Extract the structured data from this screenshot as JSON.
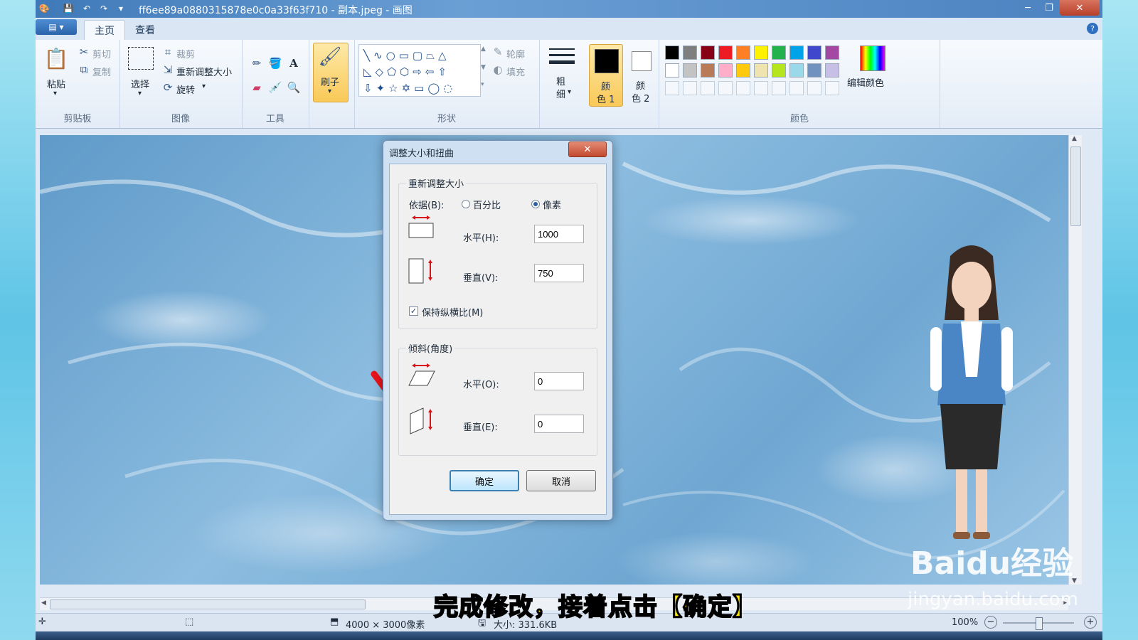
{
  "window": {
    "title": "ff6ee89a0880315878e0c0a33f63f710 - 副本.jpeg - 画图",
    "minimize": "─",
    "restore": "❐",
    "close": "✕"
  },
  "tabs": [
    {
      "label": "主页"
    },
    {
      "label": "查看"
    }
  ],
  "ribbon": {
    "clipboard": {
      "paste": "粘贴",
      "cut": "剪切",
      "copy": "复制",
      "group": "剪贴板"
    },
    "image": {
      "select": "选择",
      "crop": "裁剪",
      "resize": "重新调整大小",
      "rotate": "旋转",
      "group": "图像"
    },
    "tools": {
      "group": "工具"
    },
    "brushes": {
      "label": "刷子"
    },
    "shapes": {
      "outline": "轮廓",
      "fill": "填充",
      "group": "形状"
    },
    "size": {
      "label_line1": "粗",
      "label_line2": "细"
    },
    "color1": {
      "line1": "颜",
      "line2": "色 1"
    },
    "color2": {
      "line1": "颜",
      "line2": "色 2"
    },
    "colors": {
      "group": "颜色",
      "edit": "编辑颜色",
      "row1": [
        "#000000",
        "#7f7f7f",
        "#880015",
        "#ed1c24",
        "#ff7f27",
        "#fff200",
        "#22b14c",
        "#00a2e8",
        "#3f48cc",
        "#a349a4"
      ],
      "row2": [
        "#ffffff",
        "#c3c3c3",
        "#b97a57",
        "#ffaec9",
        "#ffc90e",
        "#efe4b0",
        "#b5e61d",
        "#99d9ea",
        "#7092be",
        "#c8bfe7"
      ]
    }
  },
  "dialog": {
    "title": "调整大小和扭曲",
    "resize_legend": "重新调整大小",
    "by_label": "依据(B):",
    "percent": "百分比",
    "pixels": "像素",
    "horizontal_label": "水平(H):",
    "horizontal_value": "1000",
    "vertical_label": "垂直(V):",
    "vertical_value": "750",
    "keep_ratio": "保持纵横比(M)",
    "skew_legend": "倾斜(角度)",
    "skew_h_label": "水平(O):",
    "skew_h_value": "0",
    "skew_v_label": "垂直(E):",
    "skew_v_value": "0",
    "ok": "确定",
    "cancel": "取消"
  },
  "status": {
    "dimensions": "4000 × 3000像素",
    "size": "大小: 331.6KB",
    "zoom": "100%"
  },
  "overlay": {
    "caption": "完成修改，接着点击【确定】",
    "watermark": "Baidu经验",
    "watermark_url": "jingyan.baidu.com"
  }
}
